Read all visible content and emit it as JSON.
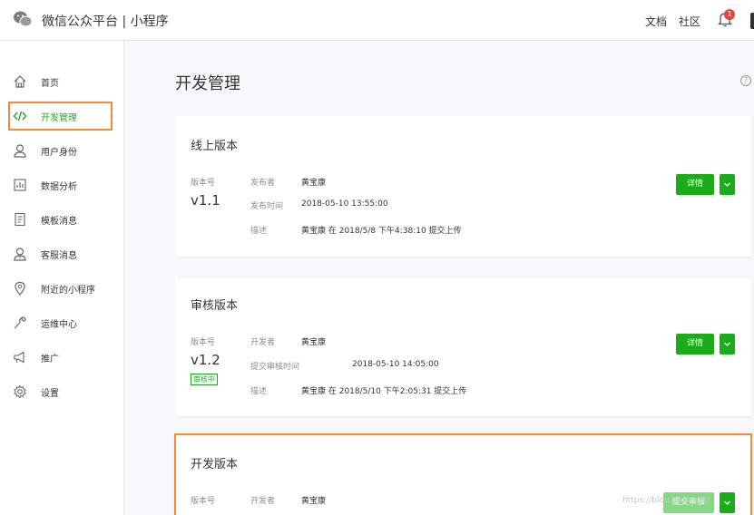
{
  "topbar": {
    "brand": "微信公众平台 | 小程序",
    "links": [
      "文档",
      "社区"
    ],
    "notification_count": "1"
  },
  "sidebar": {
    "items": [
      {
        "label": "首页",
        "icon": "home-icon"
      },
      {
        "label": "开发管理",
        "icon": "code-icon",
        "active": true
      },
      {
        "label": "用户身份",
        "icon": "user-icon"
      },
      {
        "label": "数据分析",
        "icon": "chart-icon"
      },
      {
        "label": "模板消息",
        "icon": "document-icon"
      },
      {
        "label": "客服消息",
        "icon": "support-icon"
      },
      {
        "label": "附近的小程序",
        "icon": "location-icon"
      },
      {
        "label": "运维中心",
        "icon": "wrench-icon"
      },
      {
        "label": "推广",
        "icon": "megaphone-icon"
      },
      {
        "label": "设置",
        "icon": "gear-icon"
      }
    ]
  },
  "main": {
    "title": "开发管理",
    "help_icon": "?",
    "online": {
      "title": "线上版本",
      "version_label": "版本号",
      "version": "v1.1",
      "fields": [
        {
          "key": "发布者",
          "value": "黄宝康"
        },
        {
          "key": "发布时间",
          "value": "2018-05-10 13:55:00"
        },
        {
          "key": "描述",
          "value": "黄宝康 在 2018/5/8 下午4:38:10 提交上传"
        }
      ],
      "detail_button": "详情"
    },
    "review": {
      "title": "审核版本",
      "version_label": "版本号",
      "version": "v1.2",
      "status_badge": "审核中",
      "fields": [
        {
          "key": "开发者",
          "value": "黄宝康"
        },
        {
          "key": "提交审核时间",
          "value": "2018-05-10 14:05:00"
        },
        {
          "key": "描述",
          "value": "黄宝康 在 2018/5/10 下午2:05:31 提交上传"
        }
      ],
      "detail_button": "详情"
    },
    "dev": {
      "title": "开发版本",
      "version_label": "版本号",
      "fields": [
        {
          "key": "开发者",
          "value": "黄宝康"
        }
      ],
      "submit_button": "提交审核"
    }
  },
  "watermark": "https://blog.csdn.net/...",
  "colors": {
    "accent": "#1aad19",
    "highlight": "#f08a3c",
    "badge": "#e64340"
  }
}
